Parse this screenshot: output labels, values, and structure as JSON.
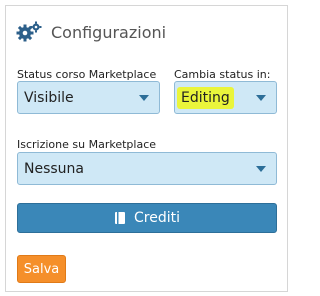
{
  "header": {
    "title": "Configurazioni",
    "icon": "gears-icon"
  },
  "status_corso": {
    "label": "Status corso Marketplace",
    "value": "Visibile"
  },
  "cambia_status": {
    "label": "Cambia status in:",
    "value": "Editing"
  },
  "iscrizione": {
    "label": "Iscrizione su Marketplace",
    "value": "Nessuna"
  },
  "buttons": {
    "crediti": "Crediti",
    "salva": "Salva"
  },
  "colors": {
    "select_bg": "#cfe8f6",
    "primary": "#3a87b8",
    "orange": "#f58f2a",
    "highlight": "#eaf53b",
    "icon": "#2c5f8a"
  }
}
